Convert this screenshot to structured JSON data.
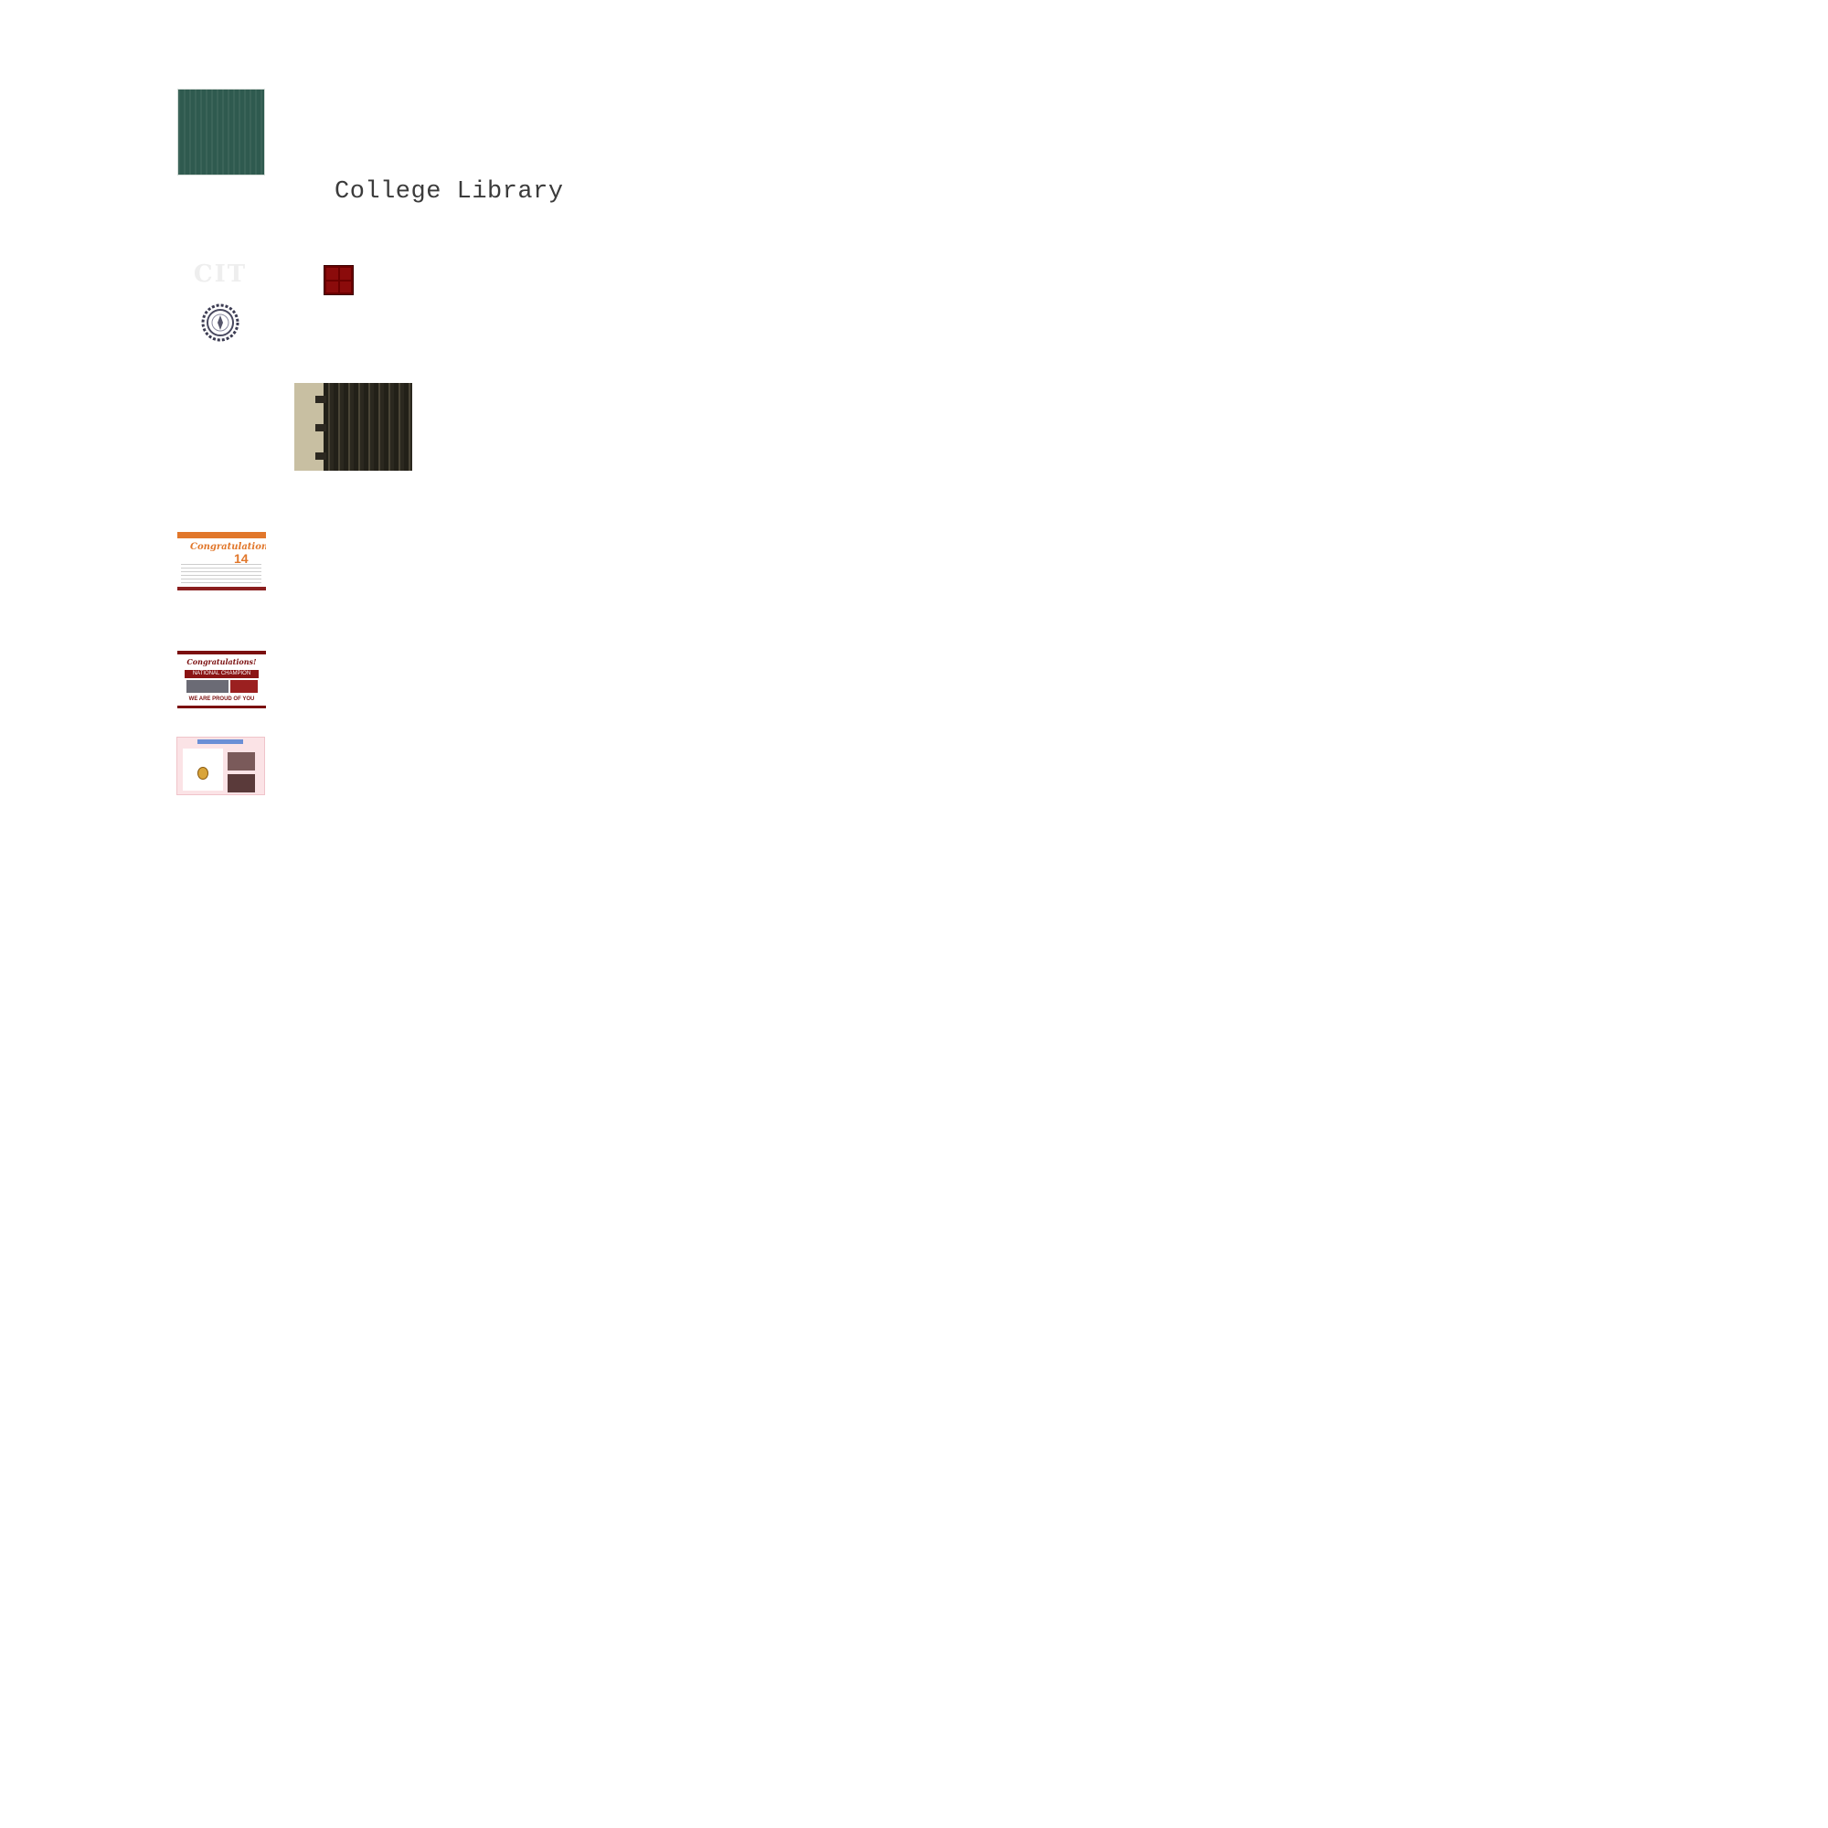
{
  "page": {
    "title": "College Library"
  },
  "logo": {
    "text": "CIT"
  },
  "posters": [
    {
      "heading": "Congratulations!",
      "number": "14"
    },
    {
      "heading": "Congratulations!",
      "banner": "NATIONAL CHAMPION",
      "footer": "WE ARE PROUD OF YOU"
    },
    {}
  ],
  "colors": {
    "accent": "#6b0000",
    "green_panel": "#2f5a4f",
    "orange": "#e1772b",
    "maroon": "#7b1010"
  },
  "icons": {
    "menu": "grid-icon"
  }
}
